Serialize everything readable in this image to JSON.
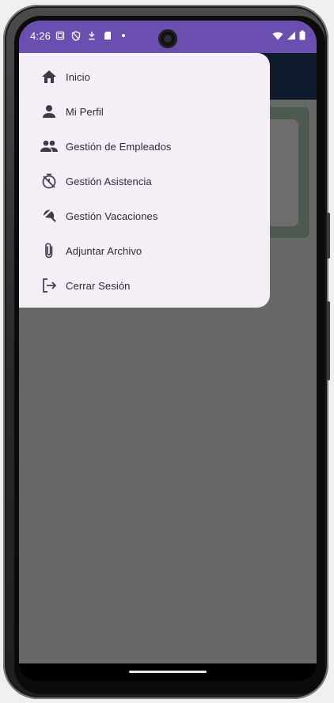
{
  "status_bar": {
    "time": "4:26",
    "left_icons": [
      "screenshot-icon",
      "shield-icon",
      "voicemail-icon",
      "sd-card-icon",
      "dot-icon"
    ],
    "right_icons": [
      "wifi-icon",
      "signal-icon",
      "battery-icon"
    ],
    "background_color": "#6b4fb0"
  },
  "drawer": {
    "items": [
      {
        "label": "Inicio",
        "icon": "home-icon"
      },
      {
        "label": "Mi Perfil",
        "icon": "person-icon"
      },
      {
        "label": "Gestión de Empleados",
        "icon": "people-icon"
      },
      {
        "label": "Gestión Asistencia",
        "icon": "timer-off-icon"
      },
      {
        "label": "Gestión Vacaciones",
        "icon": "beach-umbrella-icon"
      },
      {
        "label": "Adjuntar Archivo",
        "icon": "attach-file-icon"
      },
      {
        "label": "Cerrar Sesión",
        "icon": "logout-icon"
      }
    ]
  },
  "colors": {
    "drawer_bg": "#f4eff7",
    "scrim": "#686868",
    "header_bg": "#0e1b2d",
    "text": "#2a2a33",
    "icon": "#3e3b46"
  }
}
